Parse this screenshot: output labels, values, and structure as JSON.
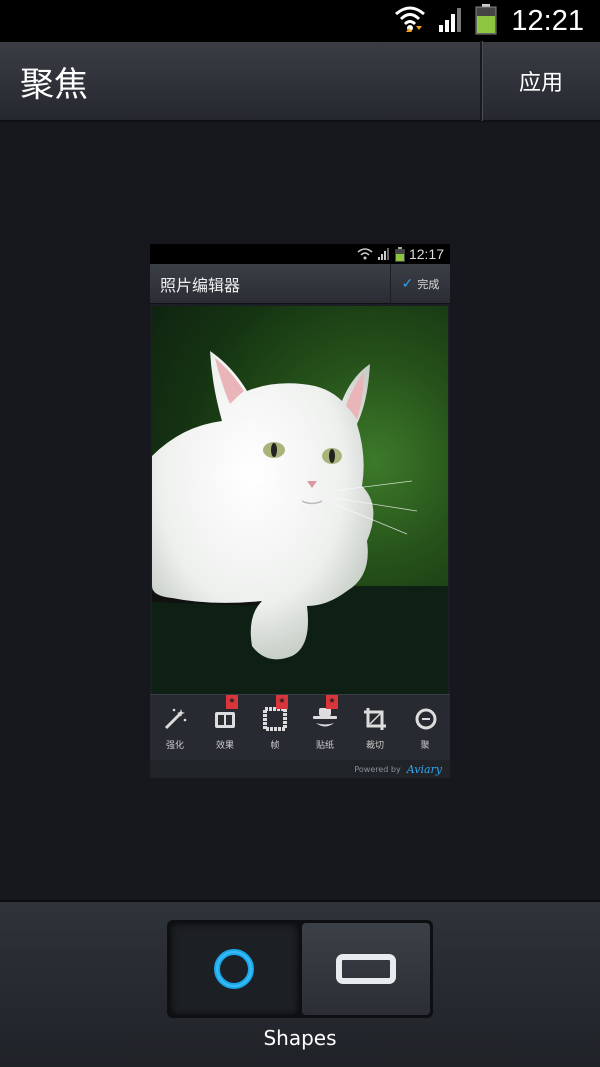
{
  "status_bar": {
    "time": "12:21",
    "icons": [
      "wifi-icon",
      "signal-icon",
      "battery-icon"
    ]
  },
  "action_bar": {
    "title": "聚焦",
    "apply_label": "应用"
  },
  "preview": {
    "status_time": "12:17",
    "title": "照片编辑器",
    "done_label": "完成",
    "tools": [
      {
        "icon": "magic-wand-icon",
        "label": "强化",
        "badge": false
      },
      {
        "icon": "effects-icon",
        "label": "效果",
        "badge": true
      },
      {
        "icon": "frame-icon",
        "label": "帧",
        "badge": true
      },
      {
        "icon": "sticker-icon",
        "label": "贴纸",
        "badge": true
      },
      {
        "icon": "crop-icon",
        "label": "裁切",
        "badge": false
      },
      {
        "icon": "focus-icon",
        "label": "聚",
        "badge": false
      }
    ],
    "powered_by": "Powered by",
    "brand": "Aviary"
  },
  "shapes": {
    "label": "Shapes",
    "options": [
      "circle",
      "rectangle"
    ],
    "selected": "circle"
  },
  "colors": {
    "accent": "#1ea6e6",
    "background": "#17181d"
  }
}
